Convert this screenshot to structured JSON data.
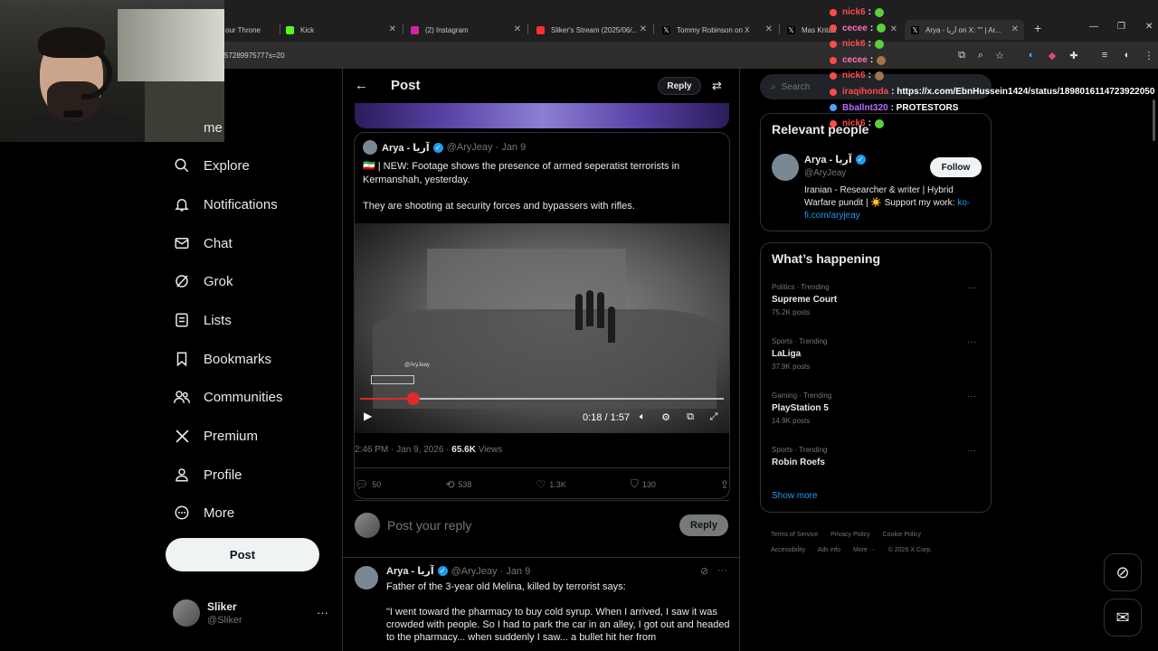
{
  "browser": {
    "tabs": [
      {
        "title": "our Throne",
        "color": "#9aa0a6"
      },
      {
        "title": "Kick",
        "color": "#53fc18"
      },
      {
        "title": "(2) Instagram",
        "color": "#d6249f"
      },
      {
        "title": "Sliker's Stream (2025/06/...",
        "color": "#ff3030"
      },
      {
        "title": "Tommy Robinson on X",
        "color": "#e7e9ea"
      },
      {
        "title": "Mas Kntaa",
        "color": "#e7e9ea"
      },
      {
        "title": "Arya - آریا on X: \"\" | Ar...",
        "color": "#e7e9ea"
      }
    ],
    "url": "57289975777s=20"
  },
  "nav": {
    "items": [
      {
        "label": "me",
        "icon": "home-icon"
      },
      {
        "label": "Explore",
        "icon": "search-icon"
      },
      {
        "label": "Notifications",
        "icon": "bell-icon"
      },
      {
        "label": "Chat",
        "icon": "mail-icon"
      },
      {
        "label": "Grok",
        "icon": "grok-icon"
      },
      {
        "label": "Lists",
        "icon": "list-icon"
      },
      {
        "label": "Bookmarks",
        "icon": "bookmark-icon"
      },
      {
        "label": "Communities",
        "icon": "people-icon"
      },
      {
        "label": "Premium",
        "icon": "x-logo-icon"
      },
      {
        "label": "Profile",
        "icon": "person-icon"
      },
      {
        "label": "More",
        "icon": "more-circle-icon"
      }
    ],
    "post_label": "Post",
    "user": {
      "name": "Sliker",
      "handle": "@Sliker"
    }
  },
  "post": {
    "header_title": "Post",
    "header_reply": "Reply",
    "quote": {
      "author": "Arya - آریا",
      "handle": "@AryJeay",
      "date": "Jan 9",
      "line1": "🇮🇷 | NEW: Footage shows the presence of armed seperatist terrorists in Kermanshah, yesterday.",
      "line2": "They are shooting at security forces and bypassers with rifles.",
      "video": {
        "time": "0:18 / 1:57",
        "watermark": "@AryJeay",
        "progress": 0.146
      }
    },
    "meta_time": "2:46 PM · Jan 9, 2026 · ",
    "meta_views_count": "65.6K",
    "meta_views_label": " Views",
    "actions": {
      "replies": "50",
      "reposts": "538",
      "likes": "1.3K",
      "bookmarks": "130"
    },
    "compose_placeholder": "Post your reply",
    "compose_button": "Reply",
    "reply": {
      "author": "Arya - آریا",
      "handle": "@AryJeay",
      "date": "Jan 9",
      "line1": "Father of the 3-year old Melina, killed by terrorist says:",
      "line2": "\"I went toward the pharmacy to buy cold syrup. When I arrived, I saw it was crowded with people. So I had to park the car in an alley, I got out and headed to the pharmacy... when suddenly I saw... a bullet hit her from"
    }
  },
  "right": {
    "search_placeholder": "Search",
    "relevant_title": "Relevant people",
    "person": {
      "name": "Arya - آریا",
      "handle": "@AryJeay",
      "follow": "Follow",
      "bio": "Iranian - Researcher & writer | Hybrid Warfare pundit | ☀️ Support my work: ",
      "link": "ko-fi.com/aryjeay"
    },
    "happening_title": "What’s happening",
    "trends": [
      {
        "category": "Politics · Trending",
        "name": "Supreme Court",
        "count": "75.2K posts"
      },
      {
        "category": "Sports · Trending",
        "name": "LaLiga",
        "count": "37.9K posts"
      },
      {
        "category": "Gaming · Trending",
        "name": "PlayStation 5",
        "count": "14.9K posts"
      },
      {
        "category": "Sports · Trending",
        "name": "Robin Roefs",
        "count": ""
      }
    ],
    "show_more": "Show more",
    "footer": [
      "Terms of Service",
      "Privacy Policy",
      "Cookie Policy",
      "Accessibility",
      "Ads info",
      "More ···",
      "© 2026 X Corp."
    ]
  },
  "chat": [
    {
      "user": "nick6",
      "color": "#ff4a4a",
      "msg": ":"
    },
    {
      "user": "cecee",
      "color": "#ff6fb0",
      "msg": ":"
    },
    {
      "user": "nick6",
      "color": "#ff4a4a",
      "msg": ":"
    },
    {
      "user": "cecee",
      "color": "#ff6fb0",
      "msg": ":"
    },
    {
      "user": "nick6",
      "color": "#ff4a4a",
      "msg": ":"
    },
    {
      "user": "iraqihonda",
      "color": "#ff4a4a",
      "msg": ": https://x.com/EbnHussein1424/status/1898016114723922050"
    },
    {
      "user": "Bballnt320",
      "color": "#b86bff",
      "msg": ": PROTESTORS"
    },
    {
      "user": "nick6",
      "color": "#ff4a4a",
      "msg": ":"
    }
  ]
}
